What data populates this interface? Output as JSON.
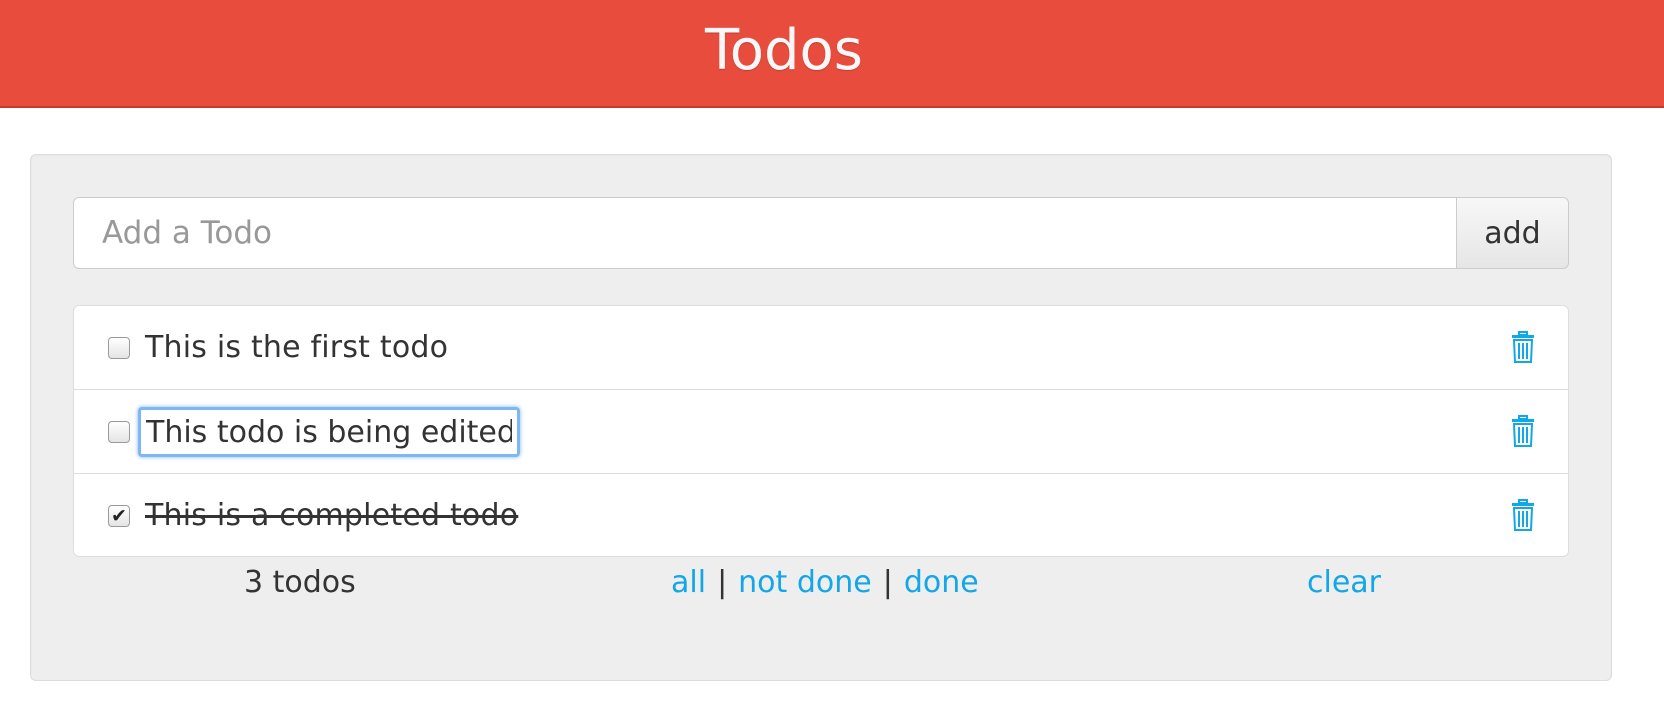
{
  "header": {
    "title": "Todos"
  },
  "new_todo": {
    "placeholder": "Add a Todo",
    "add_label": "add"
  },
  "todos": [
    {
      "text": "This is the first todo",
      "done": false
    },
    {
      "text": "This todo is being edited",
      "done": false,
      "editing": true
    },
    {
      "text": "This is a completed todo",
      "done": true
    }
  ],
  "footer": {
    "count": "3 todos",
    "filters": {
      "all": "all",
      "not_done": "not done",
      "done": "done",
      "separator": "|"
    },
    "clear": "clear"
  },
  "icons": {
    "delete": "trash-icon",
    "check": "checkmark-icon"
  },
  "colors": {
    "header": "#e84c3d",
    "link": "#12a7e6",
    "edit_focus": "#7fb7f2"
  }
}
